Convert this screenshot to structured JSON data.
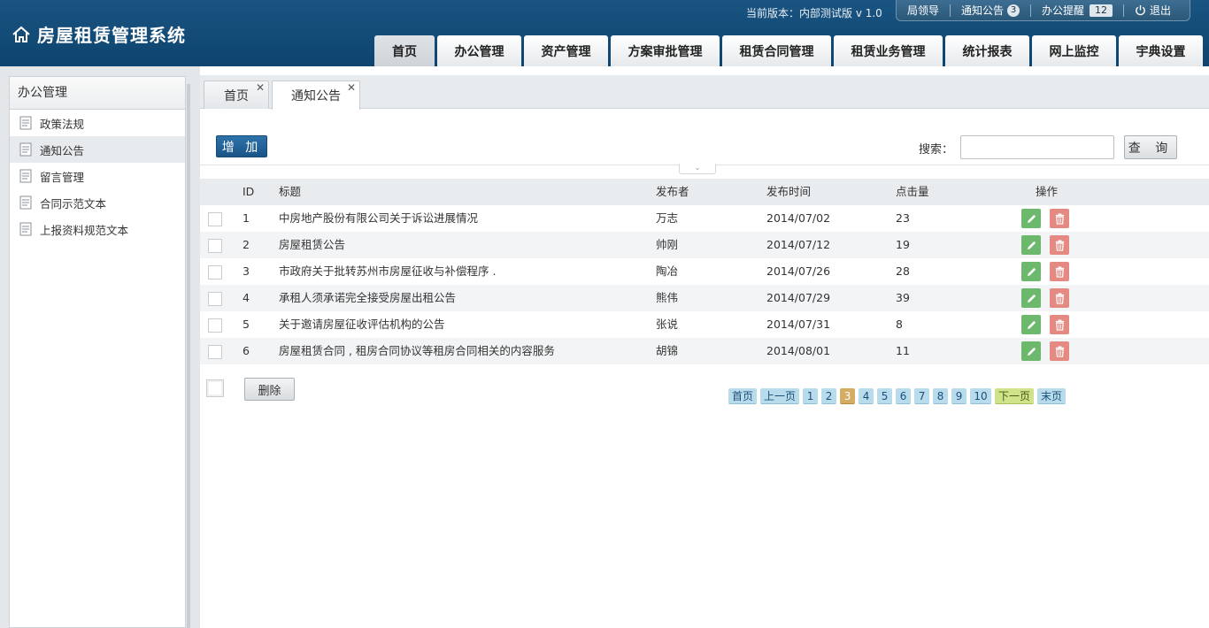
{
  "app": {
    "title": "房屋租赁管理系统",
    "version_text": "当前版本：内部测试版 v 1.0"
  },
  "toolbar": {
    "leader_guide": "局领导",
    "notice_label": "通知公告",
    "notice_count": "3",
    "office_reminder_label": "办公提醒",
    "office_reminder_count": "12",
    "logout": "退出"
  },
  "nav": [
    {
      "label": "首页",
      "active": true
    },
    {
      "label": "办公管理"
    },
    {
      "label": "资产管理"
    },
    {
      "label": "方案审批管理"
    },
    {
      "label": "租赁合同管理"
    },
    {
      "label": "租赁业务管理"
    },
    {
      "label": "统计报表"
    },
    {
      "label": "网上监控"
    },
    {
      "label": "宇典设置"
    }
  ],
  "sidebar": {
    "title": "办公管理",
    "items": [
      {
        "label": "政策法规"
      },
      {
        "label": "通知公告",
        "active": true
      },
      {
        "label": "留言管理"
      },
      {
        "label": "合同示范文本"
      },
      {
        "label": "上报资料规范文本"
      }
    ]
  },
  "tabs": [
    {
      "label": "首页"
    },
    {
      "label": "通知公告",
      "active": true
    }
  ],
  "actions": {
    "add_label": "增 加",
    "search_label": "搜索：",
    "search_value": "",
    "query_label": "查 询"
  },
  "table": {
    "headers": {
      "id": "ID",
      "title": "标题",
      "publisher": "发布者",
      "time": "发布时间",
      "clicks": "点击量",
      "ops": "操作"
    },
    "rows": [
      {
        "id": "1",
        "title": "中房地产股份有限公司关于诉讼进展情况",
        "publisher": "万志",
        "time": "2014/07/02",
        "clicks": "23"
      },
      {
        "id": "2",
        "title": "房屋租赁公告",
        "publisher": "帅刚",
        "time": "2014/07/12",
        "clicks": "19"
      },
      {
        "id": "3",
        "title": "市政府关于批转苏州市房屋征收与补偿程序 .",
        "publisher": "陶冶",
        "time": "2014/07/26",
        "clicks": "28"
      },
      {
        "id": "4",
        "title": "承租人须承诺完全接受房屋出租公告",
        "publisher": "熊伟",
        "time": "2014/07/29",
        "clicks": "39"
      },
      {
        "id": "5",
        "title": "关于邀请房屋征收评估机构的公告",
        "publisher": "张说",
        "time": "2014/07/31",
        "clicks": "8"
      },
      {
        "id": "6",
        "title": "房屋租赁合同 , 租房合同协议等租房合同相关的内容服务",
        "publisher": "胡锦",
        "time": "2014/08/01",
        "clicks": "11"
      }
    ]
  },
  "bottom": {
    "delete_label": "删除"
  },
  "pager": {
    "first": "首页",
    "prev": "上一页",
    "next": "下一页",
    "last": "末页",
    "pages": [
      "1",
      "2",
      "3",
      "4",
      "5",
      "6",
      "7",
      "8",
      "9",
      "10"
    ],
    "current": "3"
  },
  "colors": {
    "header_bg": "#0f4c75",
    "edit": "#6cb86c",
    "delete": "#e58a82",
    "page_current": "#d5ad62",
    "page_next": "#cfe38b"
  }
}
